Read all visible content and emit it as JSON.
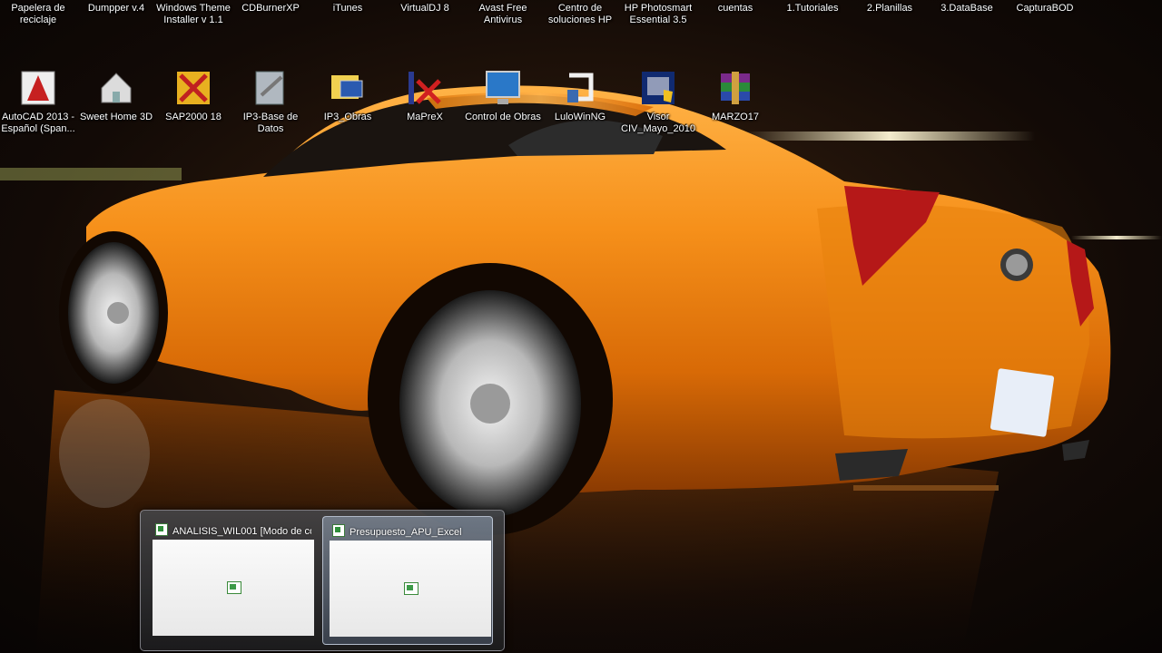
{
  "desktop": {
    "top_row": [
      {
        "label": "Papelera de\nreciclaje",
        "icon": "recycle-bin-icon"
      },
      {
        "label": "Dumpper v.4",
        "icon": "app-icon"
      },
      {
        "label": "Windows Theme\nInstaller v 1.1",
        "icon": "windows-icon"
      },
      {
        "label": "CDBurnerXP",
        "icon": "cd-icon"
      },
      {
        "label": "iTunes",
        "icon": "itunes-icon"
      },
      {
        "label": "VirtualDJ 8",
        "icon": "dj-icon"
      },
      {
        "label": "Avast Free\nAntivirus",
        "icon": "avast-icon"
      },
      {
        "label": "Centro de\nsoluciones HP",
        "icon": "hp-icon"
      },
      {
        "label": "HP Photosmart\nEssential 3.5",
        "icon": "hp-photo-icon"
      },
      {
        "label": "cuentas",
        "icon": "file-icon"
      },
      {
        "label": "1.Tutoriales",
        "icon": "file-icon"
      },
      {
        "label": "2.Planillas",
        "icon": "file-icon"
      },
      {
        "label": "3.DataBase",
        "icon": "file-icon"
      },
      {
        "label": "CapturaBOD",
        "icon": "file-icon"
      }
    ],
    "second_row": [
      {
        "label": "AutoCAD 2013 -\nEspañol (Span...",
        "icon": "autocad-icon"
      },
      {
        "label": "Sweet Home 3D",
        "icon": "house-icon"
      },
      {
        "label": "SAP2000 18",
        "icon": "sap-icon"
      },
      {
        "label": "IP3-Base de\nDatos",
        "icon": "database-icon"
      },
      {
        "label": "IP3_Obras",
        "icon": "folder-computer-icon"
      },
      {
        "label": "MaPreX",
        "icon": "maprex-icon"
      },
      {
        "label": "Control de Obras",
        "icon": "monitor-icon"
      },
      {
        "label": "LuloWinNG",
        "icon": "lulo-icon"
      },
      {
        "label": "Visor\nCIV_Mayo_2010",
        "icon": "visor-icon"
      },
      {
        "label": "MARZO17",
        "icon": "winrar-icon"
      }
    ]
  },
  "taskbar_preview": {
    "windows": [
      {
        "title": "ANALISIS_WIL001  [Modo de co...",
        "active": false
      },
      {
        "title": "Presupuesto_APU_Excel",
        "active": true
      }
    ]
  },
  "colors": {
    "car": "#f08a10",
    "background": "#0a0706",
    "excel_green": "#2f8f3a"
  }
}
